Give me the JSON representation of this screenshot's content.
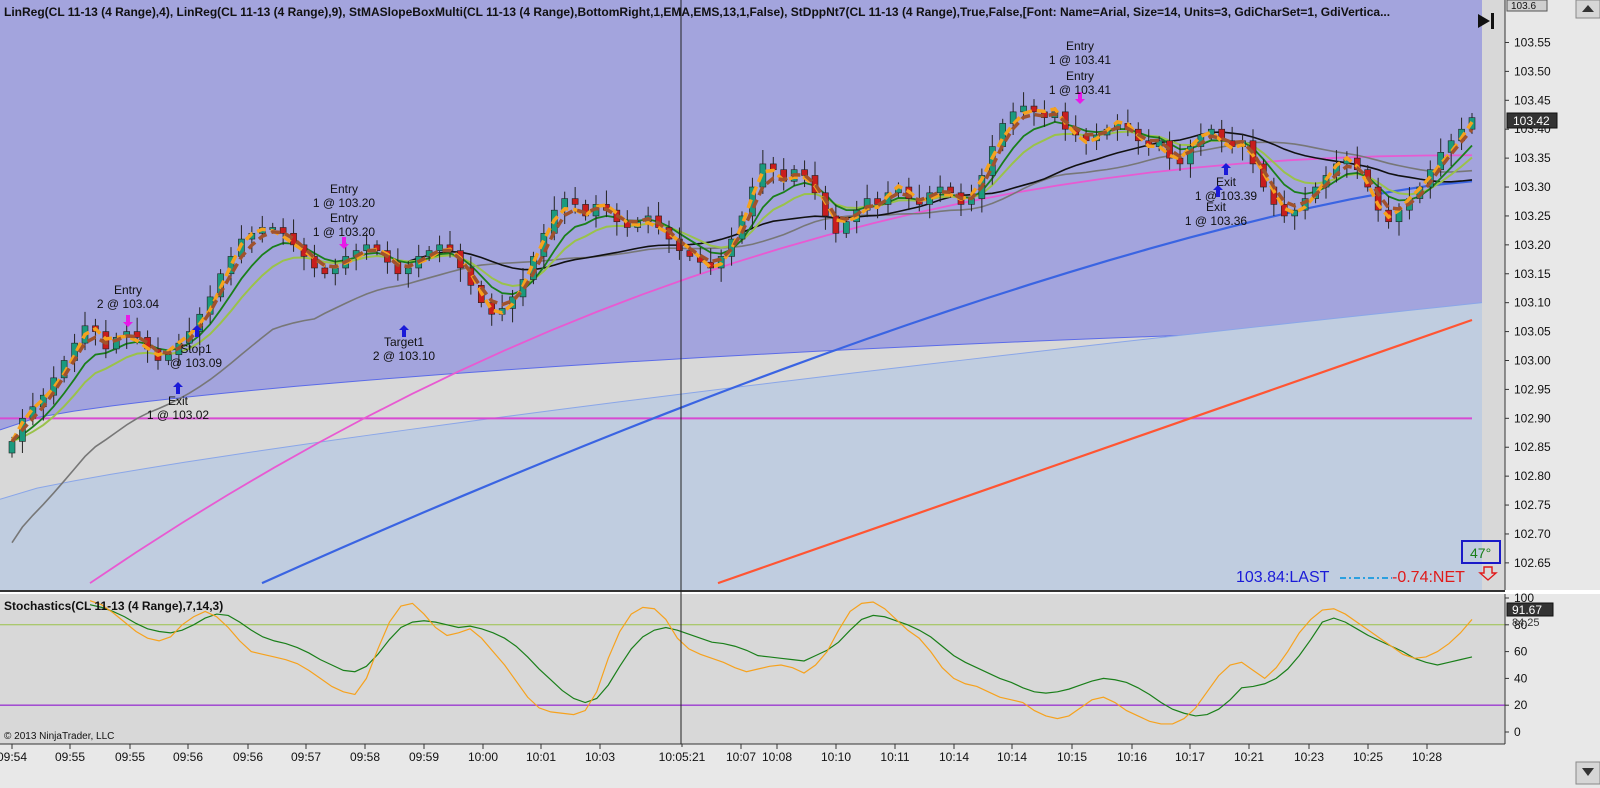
{
  "header": {
    "indicator_text": "LinReg(CL 11-13 (4 Range),4),  LinReg(CL 11-13 (4 Range),9),  StMASlopeBoxMulti(CL 11-13 (4 Range),BottomRight,1,EMA,EMS,13,1,False),  StDppNt7(CL 11-13 (4 Range),True,False,[Font: Name=Arial, Size=14, Units=3, GdiCharSet=1, GdiVertica..."
  },
  "colors": {
    "background": "#d8d8d8",
    "upper_band_fill": "#a3a4dd",
    "lower_band_fill": "#c0cde0",
    "up_candle": "#1b9a7e",
    "down_candle": "#c81e1e",
    "linreg4": "#f6a21e",
    "linreg9": "#a0522d",
    "ema_fast": "#1a7f1a",
    "ema_mid": "#9ac24a",
    "sma_black": "#111111",
    "sma_grey": "#777777",
    "magenta": "#e85ad2",
    "blue_long": "#3a64e2",
    "red_long": "#ff5533",
    "level_line": "#d74ad2",
    "stoch_d": "#1a7f1a",
    "stoch_k": "#f6a21e"
  },
  "chart_data": [
    {
      "type": "candlestick",
      "title": "CL 11-13 (4 Range)",
      "ylim": [
        102.61,
        103.62
      ],
      "y_ticks": [
        "103.55",
        "103.50",
        "103.45",
        "103.40",
        "103.35",
        "103.30",
        "103.25",
        "103.20",
        "103.15",
        "103.10",
        "103.05",
        "103.00",
        "102.95",
        "102.90",
        "102.85",
        "102.80",
        "102.75",
        "102.70",
        "102.65"
      ],
      "x_tick_labels": [
        "09:54",
        "09:55",
        "09:55",
        "09:56",
        "09:56",
        "09:57",
        "09:58",
        "09:59",
        "10:00",
        "10:01",
        "10:03",
        "10:05:21",
        "10:07",
        "10:08",
        "10:10",
        "10:11",
        "10:14",
        "10:14",
        "10:15",
        "10:16",
        "10:17",
        "10:21",
        "10:23",
        "10:25",
        "10:28"
      ],
      "crosshair_time": "10:05:21",
      "last_price": "103.42",
      "top_price_cut": "103.6",
      "horizontal_level": 102.9,
      "close_series": [
        102.86,
        102.9,
        102.92,
        102.94,
        102.97,
        103.0,
        103.03,
        103.06,
        103.05,
        103.02,
        103.04,
        103.05,
        103.04,
        103.02,
        103.0,
        103.01,
        103.03,
        103.05,
        103.08,
        103.11,
        103.15,
        103.18,
        103.21,
        103.22,
        103.23,
        103.23,
        103.22,
        103.2,
        103.18,
        103.16,
        103.15,
        103.16,
        103.18,
        103.19,
        103.2,
        103.19,
        103.17,
        103.15,
        103.16,
        103.18,
        103.19,
        103.2,
        103.19,
        103.16,
        103.13,
        103.1,
        103.08,
        103.09,
        103.11,
        103.14,
        103.18,
        103.22,
        103.26,
        103.28,
        103.27,
        103.25,
        103.27,
        103.26,
        103.24,
        103.23,
        103.24,
        103.25,
        103.23,
        103.21,
        103.19,
        103.18,
        103.17,
        103.16,
        103.18,
        103.21,
        103.25,
        103.3,
        103.34,
        103.33,
        103.31,
        103.33,
        103.32,
        103.29,
        103.25,
        103.22,
        103.24,
        103.26,
        103.28,
        103.27,
        103.29,
        103.3,
        103.28,
        103.27,
        103.29,
        103.3,
        103.29,
        103.27,
        103.28,
        103.32,
        103.37,
        103.41,
        103.43,
        103.44,
        103.43,
        103.42,
        103.43,
        103.4,
        103.39,
        103.38,
        103.39,
        103.4,
        103.41,
        103.4,
        103.38,
        103.37,
        103.38,
        103.35,
        103.34,
        103.37,
        103.39,
        103.4,
        103.38,
        103.37,
        103.38,
        103.34,
        103.3,
        103.27,
        103.25,
        103.26,
        103.28,
        103.3,
        103.32,
        103.34,
        103.35,
        103.33,
        103.3,
        103.26,
        103.24,
        103.26,
        103.28,
        103.3,
        103.33,
        103.36,
        103.38,
        103.4,
        103.42
      ],
      "trade_markers": [
        {
          "label": "Entry",
          "detail": "2 @ 103.04"
        },
        {
          "label": "Stop1",
          "detail": "@ 103.09"
        },
        {
          "label": "Exit",
          "detail": "1 @ 103.02"
        },
        {
          "label": "Entry",
          "detail": "1 @ 103.20"
        },
        {
          "label": "Entry",
          "detail": "1 @ 103.20"
        },
        {
          "label": "Target1",
          "detail": "2 @ 103.10"
        },
        {
          "label": "Entry",
          "detail": "1 @ 103.41"
        },
        {
          "label": "Entry",
          "detail": "1 @ 103.41"
        },
        {
          "label": "Exit",
          "detail": "1 @ 103.39"
        },
        {
          "label": "Exit",
          "detail": "1 @ 103.36"
        }
      ],
      "info_box": {
        "slope_angle": "47°",
        "last_text": "103.84:LAST",
        "net_text": "-0.74:NET"
      }
    },
    {
      "type": "line",
      "title": "Stochastics(CL 11-13 (4 Range),7,14,3)",
      "ylim": [
        0,
        100
      ],
      "y_ticks": [
        "100",
        "80",
        "60",
        "40",
        "20",
        "0"
      ],
      "overbought": 80,
      "oversold": 20,
      "last_value": "91.67",
      "second_value": "84.25",
      "series": [
        {
          "name": "D",
          "values": [
            95,
            93,
            90,
            86,
            81,
            77,
            75,
            74,
            76,
            80,
            85,
            88,
            87,
            82,
            76,
            71,
            68,
            66,
            63,
            59,
            54,
            50,
            46,
            45,
            49,
            58,
            69,
            78,
            82,
            83,
            82,
            80,
            78,
            79,
            77,
            74,
            70,
            64,
            56,
            47,
            39,
            31,
            25,
            22,
            25,
            35,
            49,
            62,
            71,
            76,
            78,
            76,
            73,
            70,
            67,
            66,
            64,
            61,
            57,
            56,
            55,
            54,
            53,
            57,
            61,
            67,
            76,
            84,
            87,
            86,
            83,
            80,
            76,
            71,
            64,
            57,
            52,
            48,
            44,
            40,
            37,
            33,
            30,
            29,
            30,
            32,
            35,
            38,
            40,
            39,
            37,
            33,
            28,
            22,
            17,
            14,
            12,
            13,
            17,
            24,
            33,
            34,
            36,
            40,
            47,
            57,
            69,
            82,
            85,
            82,
            77,
            72,
            68,
            64,
            60,
            55,
            52,
            50,
            52,
            54,
            56
          ]
        },
        {
          "name": "K",
          "values": [
            98,
            95,
            89,
            82,
            75,
            70,
            68,
            71,
            80,
            86,
            90,
            86,
            78,
            68,
            60,
            58,
            56,
            54,
            51,
            46,
            40,
            34,
            30,
            28,
            40,
            62,
            82,
            94,
            96,
            88,
            78,
            72,
            74,
            77,
            70,
            60,
            50,
            38,
            26,
            18,
            15,
            14,
            13,
            16,
            30,
            55,
            75,
            88,
            93,
            92,
            84,
            70,
            62,
            58,
            55,
            52,
            48,
            45,
            47,
            49,
            50,
            48,
            44,
            50,
            60,
            76,
            90,
            96,
            97,
            92,
            84,
            76,
            70,
            60,
            48,
            40,
            36,
            34,
            30,
            26,
            24,
            22,
            16,
            12,
            10,
            12,
            18,
            24,
            26,
            22,
            16,
            12,
            8,
            6,
            6,
            10,
            18,
            30,
            42,
            50,
            52,
            46,
            40,
            48,
            60,
            74,
            84,
            91,
            92,
            88,
            82,
            76,
            70,
            64,
            58,
            55,
            56,
            60,
            66,
            74,
            84
          ]
        }
      ]
    }
  ]
}
